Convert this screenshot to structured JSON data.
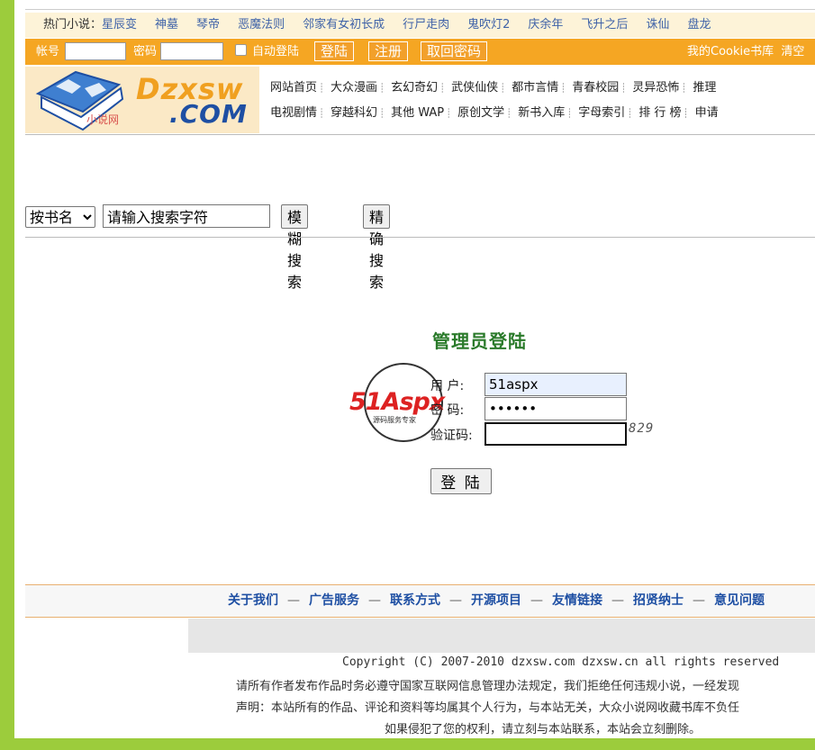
{
  "hot": {
    "label": "热门小说：",
    "links": [
      "星辰变",
      "神墓",
      "琴帝",
      "恶魔法则",
      "邻家有女初长成",
      "行尸走肉",
      "鬼吹灯2",
      "庆余年",
      "飞升之后",
      "诛仙",
      "盘龙"
    ]
  },
  "login_bar": {
    "account_label": "帐号",
    "password_label": "密码",
    "auto_login_label": "自动登陆",
    "login_btn": "登陆",
    "register_btn": "注册",
    "retrieve_btn": "取回密码",
    "cookie_link": "我的Cookie书库",
    "clear_link": "清空"
  },
  "logo": {
    "brand_top": "Dzxsw",
    "brand_bottom": ".COM",
    "sub": "小说网"
  },
  "nav": {
    "row1": [
      "网站首页",
      "大众漫画",
      "玄幻奇幻",
      "武侠仙侠",
      "都市言情",
      "青春校园",
      "灵异恐怖",
      "推理"
    ],
    "row2": [
      "电视剧情",
      "穿越科幻",
      "其他 WAP",
      "原创文学",
      "新书入库",
      "字母索引",
      "排 行 榜",
      "申请"
    ]
  },
  "search": {
    "select_value": "按书名",
    "input_value": "请输入搜索字符",
    "fuzzy_btn": "模糊搜索",
    "exact_btn": "精确搜索"
  },
  "admin": {
    "title": "管理员登陆",
    "user_label": "用  户:",
    "user_value": "51aspx",
    "pwd_label": "密  码:",
    "pwd_value": "••••••",
    "code_label": "验证码:",
    "code_value": "",
    "captcha": "829",
    "submit": "登 陆"
  },
  "watermark": {
    "brand": "51Aspx",
    "tagline": "源码服务专家"
  },
  "footer": {
    "links": [
      "关于我们",
      "广告服务",
      "联系方式",
      "开源项目",
      "友情链接",
      "招贤纳士",
      "意见问题"
    ],
    "separator": "—",
    "copyright": "Copyright (C) 2007-2010 dzxsw.com dzxsw.cn all rights reserved",
    "notice1": "请所有作者发布作品时务必遵守国家互联网信息管理办法规定，我们拒绝任何违规小说，一经发现",
    "notice2": "声明：本站所有的作品、评论和资料等均属其个人行为，与本站无关，大众小说网收藏书库不负任",
    "notice3": "如果侵犯了您的权利，请立刻与本站联系，本站会立刻删除。"
  },
  "colors": {
    "side_bar": "#9ccc3c",
    "login_bar": "#f5a623",
    "link_blue": "#3f63a8",
    "admin_green": "#2a7a2a"
  }
}
